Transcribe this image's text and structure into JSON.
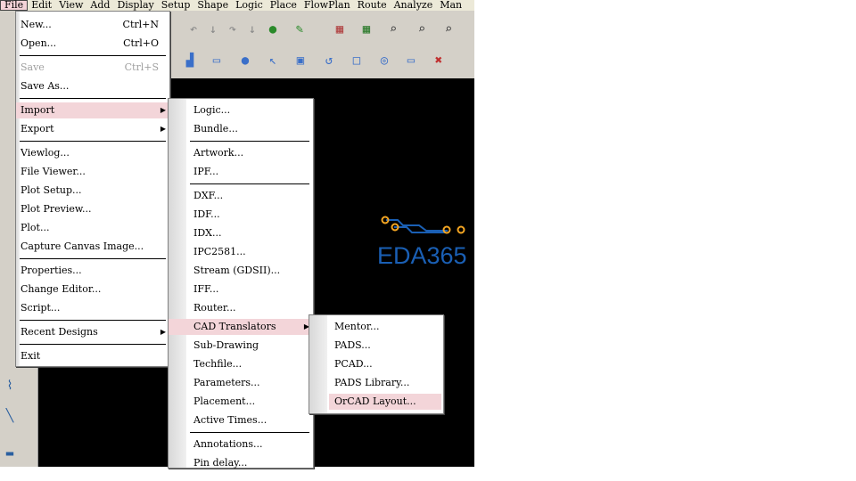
{
  "menubar": [
    "File",
    "Edit",
    "View",
    "Add",
    "Display",
    "Setup",
    "Shape",
    "Logic",
    "Place",
    "FlowPlan",
    "Route",
    "Analyze",
    "Man"
  ],
  "file_menu": [
    {
      "label": "New...",
      "shortcut": "Ctrl+N"
    },
    {
      "label": "Open...",
      "shortcut": "Ctrl+O"
    },
    {
      "label": "Save",
      "shortcut": "Ctrl+S",
      "disabled": true
    },
    {
      "label": "Save As..."
    },
    {
      "label": "Import",
      "submenu": true,
      "highlighted": true
    },
    {
      "label": "Export",
      "submenu": true
    },
    {
      "label": "Viewlog..."
    },
    {
      "label": "File Viewer..."
    },
    {
      "label": "Plot Setup..."
    },
    {
      "label": "Plot Preview..."
    },
    {
      "label": "Plot..."
    },
    {
      "label": "Capture Canvas Image..."
    },
    {
      "label": "Properties..."
    },
    {
      "label": "Change Editor..."
    },
    {
      "label": "Script..."
    },
    {
      "label": "Recent Designs",
      "submenu": true
    },
    {
      "label": "Exit"
    }
  ],
  "import_menu": [
    {
      "label": "Logic..."
    },
    {
      "label": "Bundle..."
    },
    {
      "label": "Artwork..."
    },
    {
      "label": "IPF..."
    },
    {
      "label": "DXF..."
    },
    {
      "label": "IDF..."
    },
    {
      "label": "IDX..."
    },
    {
      "label": "IPC2581..."
    },
    {
      "label": "Stream (GDSII)..."
    },
    {
      "label": "IFF..."
    },
    {
      "label": "Router..."
    },
    {
      "label": "CAD Translators",
      "submenu": true,
      "highlighted": true
    },
    {
      "label": "Sub-Drawing"
    },
    {
      "label": "Techfile..."
    },
    {
      "label": "Parameters..."
    },
    {
      "label": "Placement..."
    },
    {
      "label": "Active Times..."
    },
    {
      "label": "Annotations..."
    },
    {
      "label": "Pin delay..."
    }
  ],
  "cad_menu": [
    {
      "label": "Mentor..."
    },
    {
      "label": "PADS..."
    },
    {
      "label": "PCAD..."
    },
    {
      "label": "PADS Library..."
    },
    {
      "label": "OrCAD Layout...",
      "highlighted": true
    }
  ],
  "logo_text": "EDA365",
  "colors": {
    "menu_highlight": "#f3d5d9",
    "canvas": "#000000",
    "logo_blue": "#1a5fb4",
    "logo_orange": "#f5a623"
  }
}
